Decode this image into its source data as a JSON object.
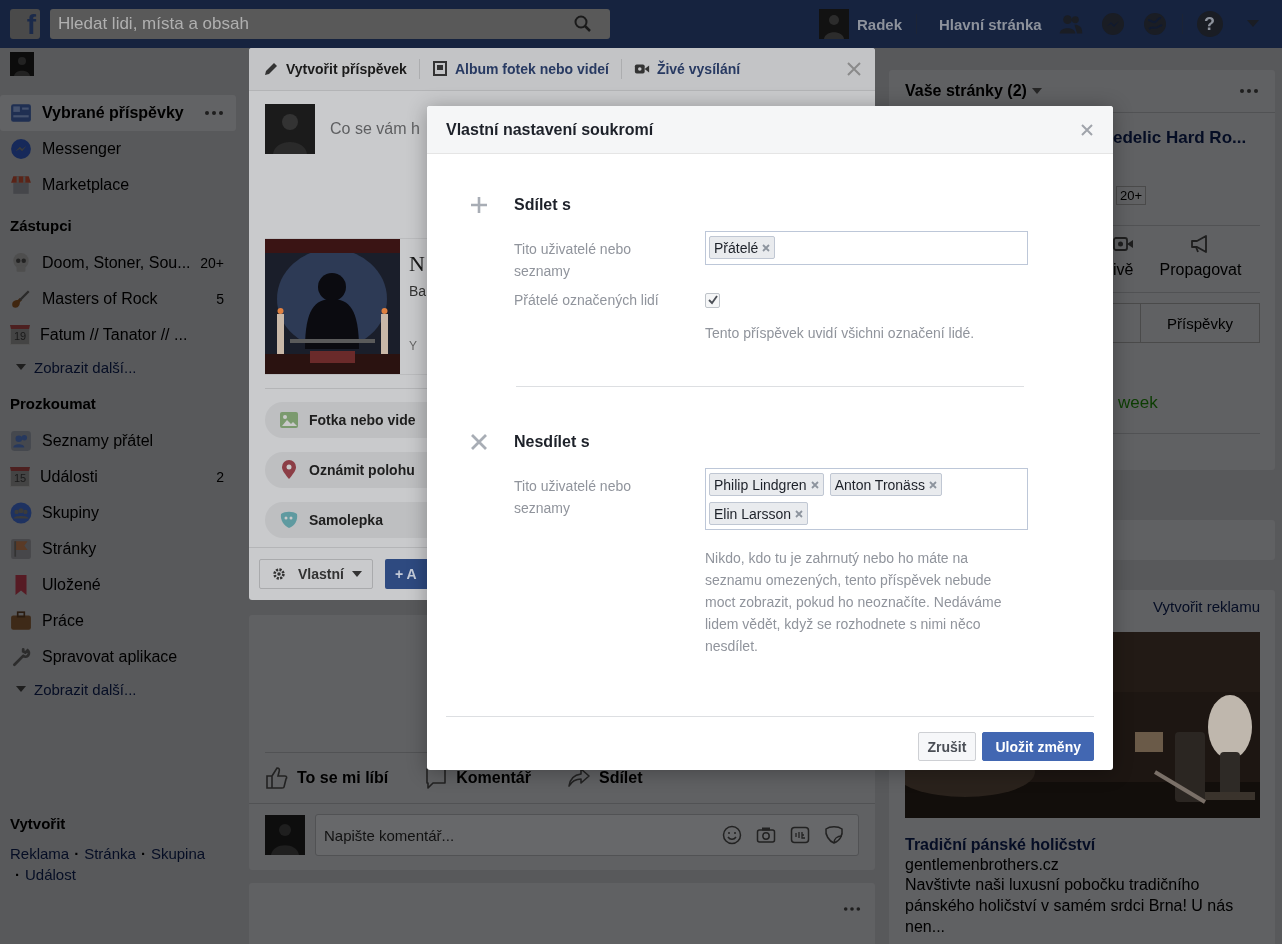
{
  "header": {
    "logo": "f",
    "search": {
      "placeholder": "Hledat lidi, místa a obsah"
    },
    "user": "Radek",
    "home": "Hlavní stránka",
    "help": "?"
  },
  "sidebar": {
    "items": [
      {
        "label": "Vybrané příspěvky",
        "selected": true
      },
      {
        "label": "Messenger",
        "selected": false
      },
      {
        "label": "Marketplace",
        "selected": false
      }
    ],
    "groups": [
      {
        "title": "Zástupci",
        "items": [
          {
            "label": "Doom, Stoner, Sou...",
            "count": "20+",
            "selected": false
          },
          {
            "label": "Masters of Rock",
            "count": "5",
            "selected": false
          },
          {
            "label": "Fatum // Tanator // ...",
            "date": "19",
            "selected": false
          }
        ],
        "more": "Zobrazit další..."
      },
      {
        "title": "Prozkoumat",
        "items": [
          {
            "label": "Seznamy přátel",
            "selected": false
          },
          {
            "label": "Události",
            "count": "2",
            "date": "15",
            "selected": false
          },
          {
            "label": "Skupiny",
            "selected": false
          },
          {
            "label": "Stránky",
            "selected": false
          },
          {
            "label": "Uložené",
            "selected": false
          },
          {
            "label": "Práce",
            "selected": false
          },
          {
            "label": "Spravovat aplikace",
            "selected": false
          }
        ],
        "more": "Zobrazit další..."
      }
    ],
    "create": {
      "title": "Vytvořit",
      "links": [
        "Reklama",
        "Stránka",
        "Skupina",
        "Událost"
      ],
      "separator": "·"
    }
  },
  "composer": {
    "tabs": [
      {
        "label": "Vytvořit příspěvek",
        "selected": true
      },
      {
        "label": "Album fotek nebo videí",
        "selected": false
      },
      {
        "label": "Živé vysílání",
        "selected": false
      }
    ],
    "prompt": "Co se vám h",
    "shared": {
      "title": "N",
      "subtitle": "Ba",
      "source": "Y"
    },
    "actions": [
      "Fotka nebo vide",
      "Oznámit polohu",
      "Samolepka"
    ],
    "privacy": "Vlastní",
    "post_button": "+ A"
  },
  "post": {
    "actions": [
      "To se mi líbí",
      "Komentář",
      "Sdílet"
    ],
    "comment": {
      "placeholder": "Napište komentář..."
    }
  },
  "pages": {
    "title": "Vaše stránky (2)",
    "page_name": "edelic Hard Ro...",
    "badge": "20+",
    "actions": [
      "ivě",
      "Propagovat"
    ],
    "tabs": [
      "Příspěvky"
    ],
    "trend": "week"
  },
  "ad": {
    "create": "Vytvořit reklamu",
    "title": "Tradiční pánské holičství",
    "url": "gentlemenbrothers.cz",
    "text": "Navštivte naši luxusní pobočku tradičního pánského holičství v samém srdci Brna! U nás nen..."
  },
  "dialog": {
    "title": "Vlastní nastavení soukromí",
    "sections": [
      {
        "kind": "include",
        "heading": "Sdílet s",
        "label": "Tito uživatelé nebo seznamy",
        "tokens": [
          "Přátelé"
        ],
        "option": {
          "label": "Přátelé označených lidí",
          "checked": true
        },
        "hint": "Tento příspěvek uvidí všichni označení lidé."
      },
      {
        "kind": "exclude",
        "heading": "Nesdílet s",
        "label": "Tito uživatelé nebo seznamy",
        "tokens": [
          "Philip Lindgren",
          "Anton Tronäss",
          "Elin Larsson"
        ],
        "hint": "Nikdo, kdo tu je zahrnutý nebo ho máte na seznamu omezených, tento příspěvek nebude moct zobrazit, pokud ho neoznačíte. Nedáváme lidem vědět, když se rozhodnete s nimi něco nesdílet."
      }
    ],
    "buttons": [
      {
        "label": "Zrušit",
        "kind": "secondary"
      },
      {
        "label": "Uložit změny",
        "kind": "primary"
      }
    ]
  }
}
